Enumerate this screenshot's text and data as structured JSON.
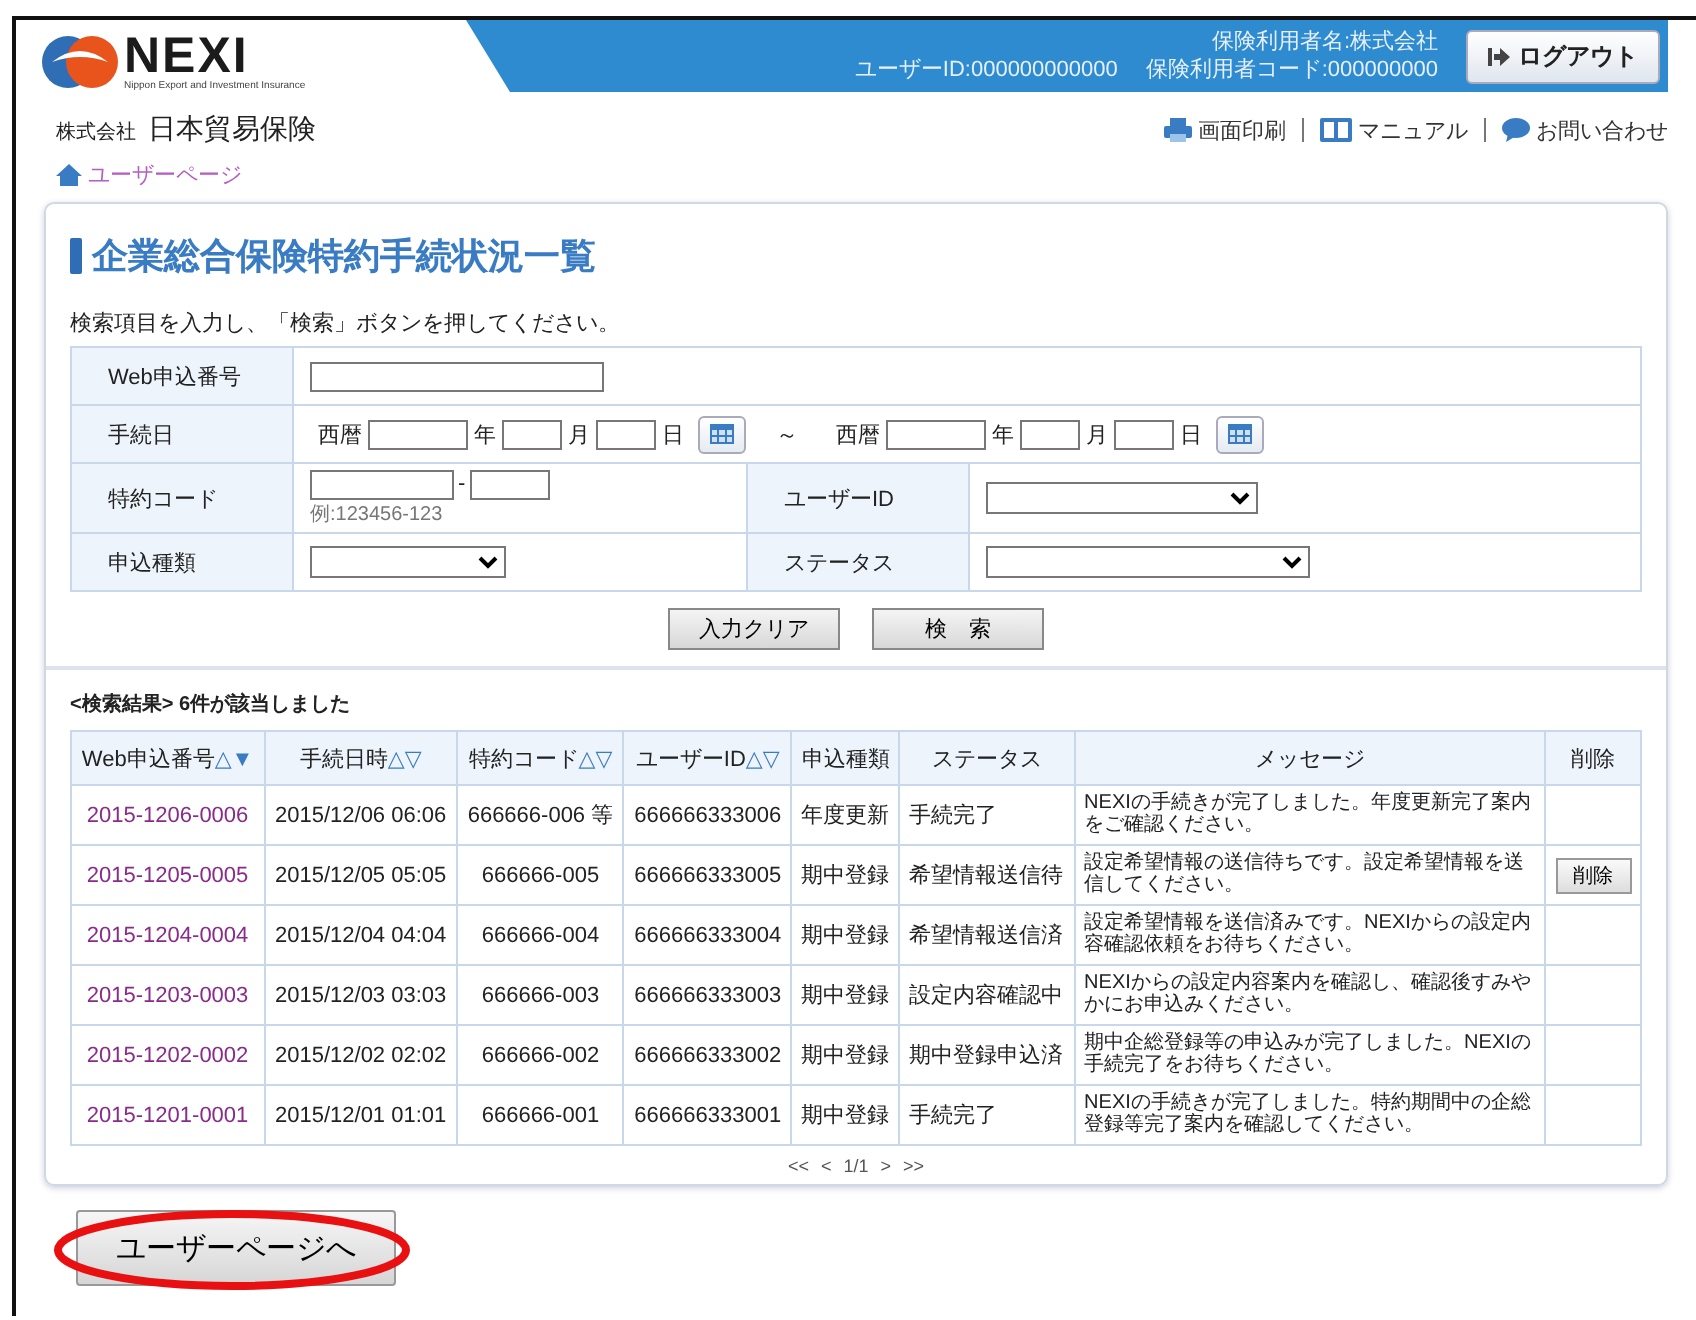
{
  "header": {
    "logo_text": "NEXI",
    "logo_subtitle": "Nippon Export and Investment Insurance",
    "company_prefix": "株式会社",
    "company_name": "日本貿易保険",
    "user_id": "ユーザーID:000000000000",
    "insurer_name": "保険利用者名:株式会社",
    "insurer_code": "保険利用者コード:000000000",
    "logout_button": "ログアウト",
    "links": [
      {
        "kind": "print",
        "label": "画面印刷"
      },
      {
        "kind": "manual",
        "label": "マニュアル"
      },
      {
        "kind": "contact",
        "label": "お問い合わせ"
      }
    ]
  },
  "breadcrumb": "ユーザーページ",
  "page_title": "企業総合保険特約手続状況一覧",
  "instruction": "検索項目を入力し、「検索」ボタンを押してください。",
  "form": {
    "web_number_label": "Web申込番号",
    "date_label": "手続日",
    "date_ranges": [
      {
        "era": "西暦",
        "year": "年",
        "month": "月",
        "day": "日"
      },
      {
        "era": "西暦",
        "year": "年",
        "month": "月",
        "day": "日"
      }
    ],
    "tilde": "～",
    "contract_label": "特約コード",
    "contract_separator": "-",
    "contract_example": "例:123456-123",
    "user_id_label": "ユーザーID",
    "app_type_label": "申込種類",
    "status_label": "ステータス",
    "clear_button": "入力クリア",
    "search_button": "検　索"
  },
  "results": {
    "prefix": "<検索結果>",
    "count": "6件が該当しました",
    "columns": [
      {
        "label": "Web申込番号",
        "sort": "△▼"
      },
      {
        "label": "手続日時",
        "sort": "△▽"
      },
      {
        "label": "特約コード",
        "sort": "△▽"
      },
      {
        "label": "ユーザーID",
        "sort": "△▽"
      },
      {
        "label": "申込種類"
      },
      {
        "label": "ステータス"
      },
      {
        "label": "メッセージ"
      },
      {
        "label": "削除"
      }
    ],
    "rows": [
      {
        "number": "2015-1206-0006",
        "datetime": "2015/12/06 06:06",
        "code": "666666-006 等",
        "user_id": "666666333006",
        "type": "年度更新",
        "status": "手続完了",
        "message": "NEXIの手続きが完了しました。年度更新完了案内をご確認ください。"
      },
      {
        "number": "2015-1205-0005",
        "datetime": "2015/12/05 05:05",
        "code": "666666-005",
        "user_id": "666666333005",
        "type": "期中登録",
        "status": "希望情報送信待",
        "message": "設定希望情報の送信待ちです。設定希望情報を送信してください。",
        "delete_button": "削除"
      },
      {
        "number": "2015-1204-0004",
        "datetime": "2015/12/04 04:04",
        "code": "666666-004",
        "user_id": "666666333004",
        "type": "期中登録",
        "status": "希望情報送信済",
        "message": "設定希望情報を送信済みです。NEXIからの設定内容確認依頼をお待ちください。"
      },
      {
        "number": "2015-1203-0003",
        "datetime": "2015/12/03 03:03",
        "code": "666666-003",
        "user_id": "666666333003",
        "type": "期中登録",
        "status": "設定内容確認中",
        "message": "NEXIからの設定内容案内を確認し、確認後すみやかにお申込みください。"
      },
      {
        "number": "2015-1202-0002",
        "datetime": "2015/12/02 02:02",
        "code": "666666-002",
        "user_id": "666666333002",
        "type": "期中登録",
        "status": "期中登録申込済",
        "message": "期中企総登録等の申込みが完了しました。NEXIの手続完了をお待ちください。"
      },
      {
        "number": "2015-1201-0001",
        "datetime": "2015/12/01 01:01",
        "code": "666666-001",
        "user_id": "666666333001",
        "type": "期中登録",
        "status": "手続完了",
        "message": "NEXIの手続きが完了しました。特約期間中の企総登録等完了案内を確認してください。"
      }
    ],
    "pagination": [
      "<<",
      "<",
      "1/1",
      ">",
      ">>"
    ]
  },
  "back_button": {
    "label": "ユーザーページへ",
    "highlighted": true
  }
}
